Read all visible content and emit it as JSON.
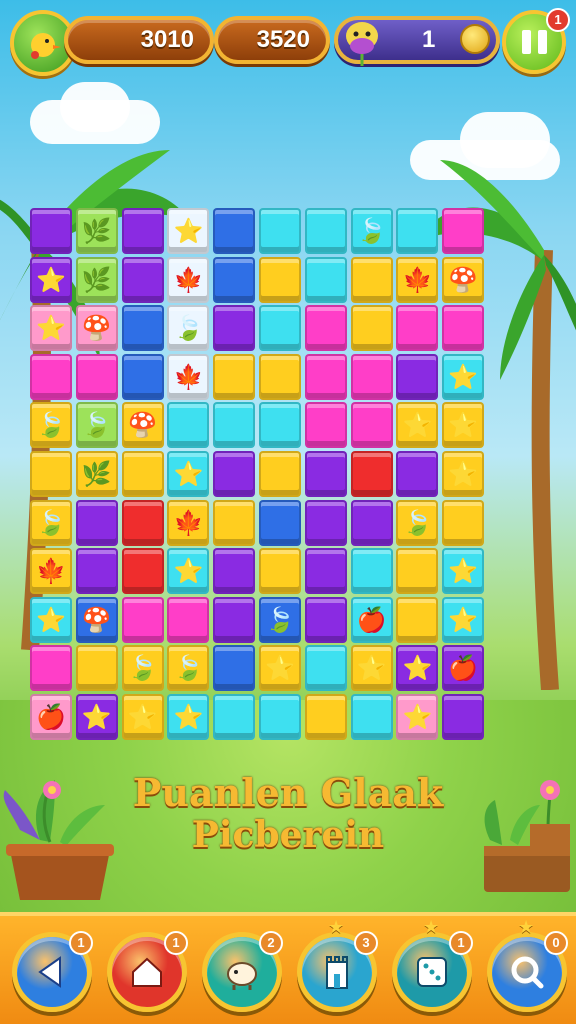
{
  "hud": {
    "score_left": "3010",
    "score_right": "3520",
    "moves": "1",
    "pause_badge": "1"
  },
  "title": {
    "line1": "Puanlen Glaak",
    "line2": "Picberein"
  },
  "toolbar": {
    "tools": [
      {
        "name": "back",
        "badge": "1",
        "icon": "triangle-left-icon",
        "color": "#2e7fe0"
      },
      {
        "name": "home",
        "badge": "1",
        "icon": "house-icon",
        "color": "#e0352b"
      },
      {
        "name": "pet",
        "badge": "2",
        "icon": "sheep-icon",
        "color": "#1fae9c"
      },
      {
        "name": "castle",
        "badge": "3",
        "icon": "tower-icon",
        "color": "#2aa5cf"
      },
      {
        "name": "dice",
        "badge": "1",
        "icon": "dice-icon",
        "color": "#1e9aa8"
      },
      {
        "name": "search",
        "badge": "0",
        "icon": "search-icon",
        "color": "#2e7fe0"
      }
    ]
  },
  "board": {
    "colors": {
      "P": "#8a2be2",
      "B": "#2f6fe6",
      "C": "#3ee0f0",
      "Y": "#ffce1f",
      "M": "#ff3ec8",
      "R": "#ef2d2d",
      "G": "#9de25a",
      "W": "#ecf6ff",
      "K": "#ff9acb",
      "T": "#29c9e8"
    },
    "rows": [
      [
        "P",
        "G",
        "P",
        "W",
        "B",
        "C",
        "C",
        "C",
        "C",
        "M"
      ],
      [
        "P",
        "G",
        "P",
        "W",
        "B",
        "Y",
        "C",
        "Y",
        "Y",
        "Y"
      ],
      [
        "K",
        "K",
        "B",
        "W",
        "P",
        "C",
        "M",
        "Y",
        "M",
        "M"
      ],
      [
        "M",
        "M",
        "B",
        "W",
        "Y",
        "Y",
        "M",
        "M",
        "P",
        "C"
      ],
      [
        "Y",
        "G",
        "Y",
        "C",
        "C",
        "C",
        "M",
        "M",
        "Y",
        "Y"
      ],
      [
        "Y",
        "Y",
        "Y",
        "C",
        "P",
        "Y",
        "P",
        "R",
        "P",
        "Y"
      ],
      [
        "Y",
        "P",
        "R",
        "Y",
        "Y",
        "B",
        "P",
        "P",
        "Y",
        "Y"
      ],
      [
        "Y",
        "P",
        "R",
        "C",
        "P",
        "Y",
        "P",
        "C",
        "Y",
        "C"
      ],
      [
        "C",
        "B",
        "M",
        "M",
        "P",
        "B",
        "P",
        "C",
        "Y",
        "C"
      ],
      [
        "M",
        "Y",
        "Y",
        "Y",
        "B",
        "Y",
        "C",
        "Y",
        "P",
        "P"
      ],
      [
        "K",
        "P",
        "Y",
        "C",
        "C",
        "C",
        "Y",
        "C",
        "K",
        "P"
      ]
    ],
    "icons": {
      "0-1": "🌿",
      "0-3": "⭐",
      "0-7": "🍃",
      "0-9": "",
      "1-0": "⭐",
      "1-1": "🌿",
      "1-3": "🍁",
      "1-8": "🍁",
      "1-9": "🍄",
      "2-0": "⭐",
      "2-1": "🍄",
      "2-3": "🍃",
      "3-3": "🍁",
      "3-9": "⭐",
      "4-0": "🍃",
      "4-1": "🍃",
      "4-2": "🍄",
      "4-8": "⭐",
      "4-9": "⭐",
      "5-1": "🌿",
      "5-3": "⭐",
      "5-9": "⭐",
      "6-0": "🍃",
      "6-3": "🍁",
      "6-8": "🍃",
      "7-0": "🍁",
      "7-3": "⭐",
      "7-9": "⭐",
      "8-0": "⭐",
      "8-1": "🍄",
      "8-5": "🍃",
      "8-7": "🍎",
      "8-9": "⭐",
      "9-2": "🍃",
      "9-3": "🍃",
      "9-5": "⭐",
      "9-7": "⭐",
      "9-8": "⭐",
      "9-9": "🍎",
      "10-0": "🍎",
      "10-1": "⭐",
      "10-2": "⭐",
      "10-3": "⭐",
      "10-8": "⭐"
    }
  }
}
